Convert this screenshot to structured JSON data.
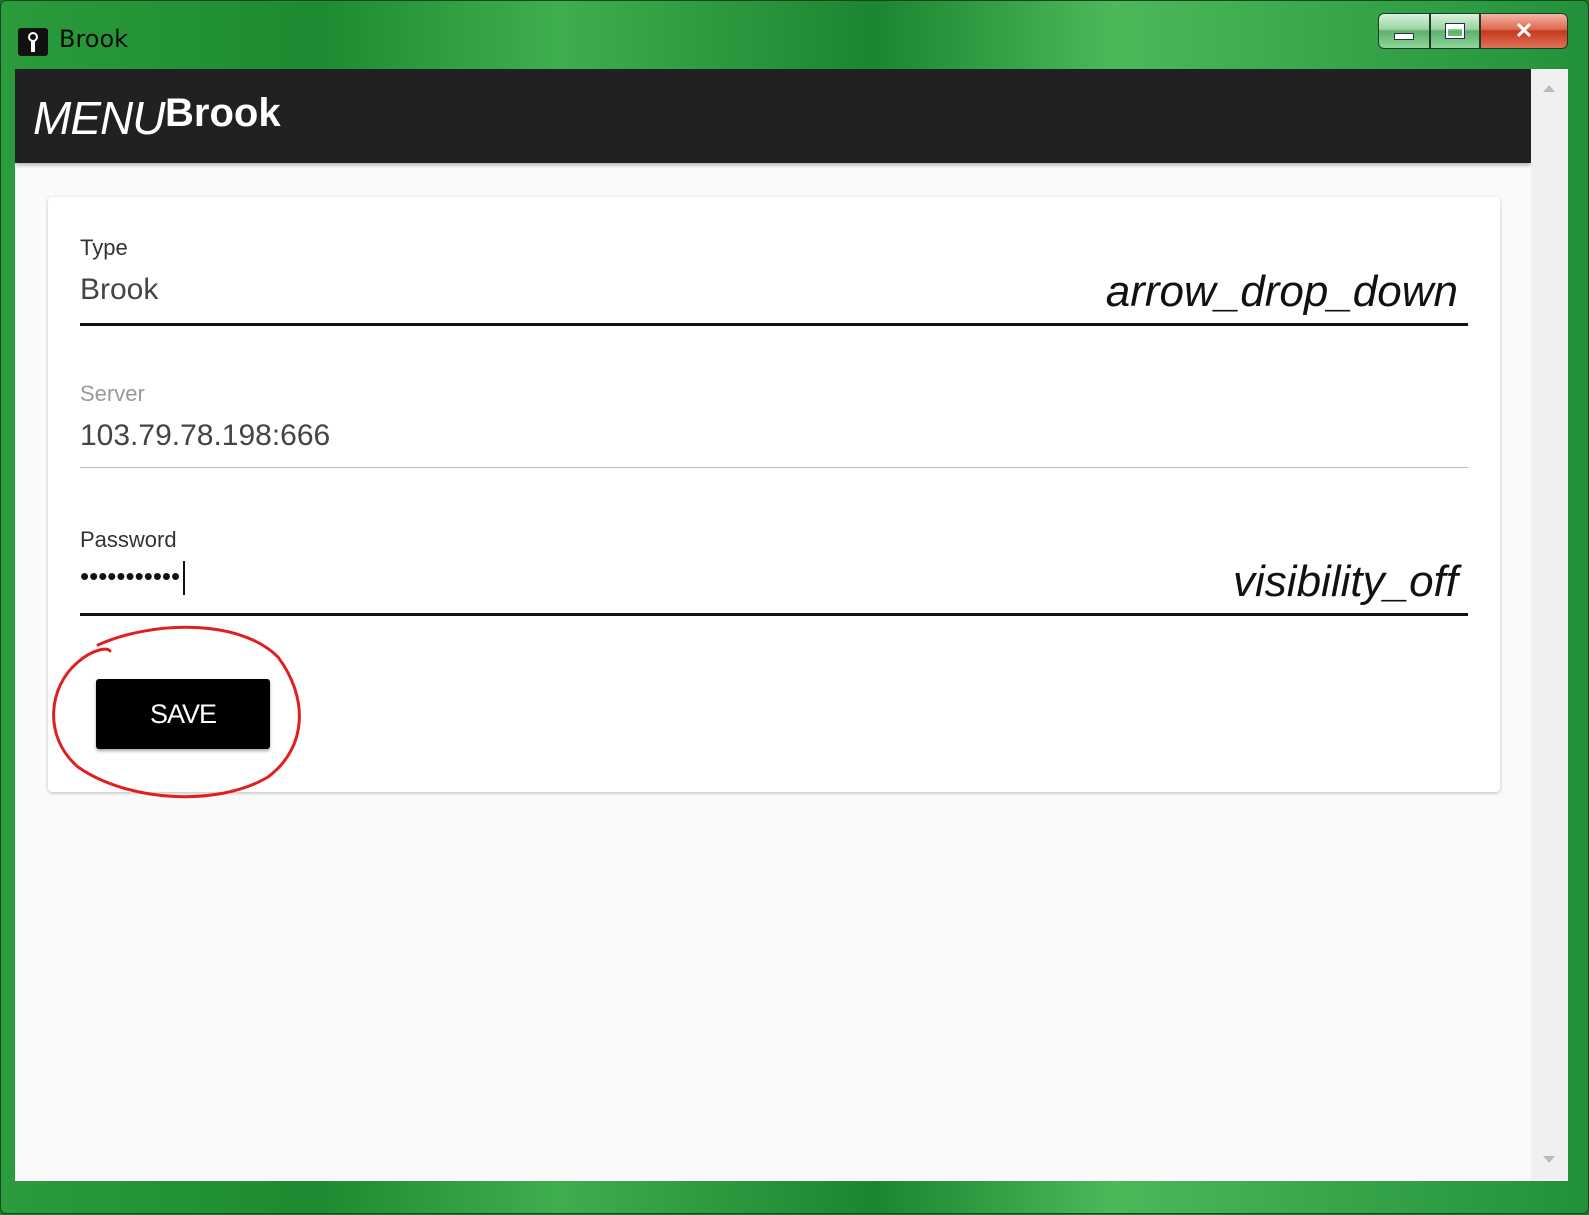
{
  "window": {
    "title": "Brook"
  },
  "appbar": {
    "menu": "MENU",
    "title": "Brook"
  },
  "form": {
    "type": {
      "label": "Type",
      "value": "Brook",
      "icon": "arrow_drop_down"
    },
    "server": {
      "label": "Server",
      "value": "103.79.78.198:666"
    },
    "password": {
      "label": "Password",
      "value": "•••••••••••",
      "icon": "visibility_off"
    },
    "save_label": "SAVE"
  }
}
